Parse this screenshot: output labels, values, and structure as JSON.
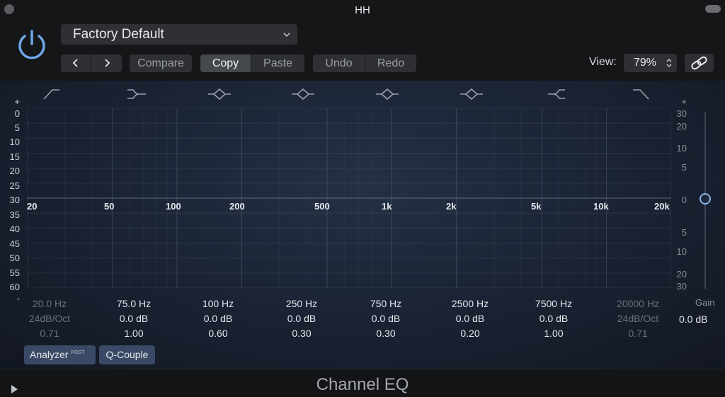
{
  "window": {
    "title": "HH"
  },
  "header": {
    "preset": "Factory Default",
    "compare_label": "Compare",
    "copy_label": "Copy",
    "paste_label": "Paste",
    "undo_label": "Undo",
    "redo_label": "Redo",
    "view_label": "View:",
    "view_value": "79%"
  },
  "graph": {
    "db_scale_left": [
      "+",
      "0",
      "5",
      "10",
      "15",
      "20",
      "25",
      "30",
      "35",
      "40",
      "45",
      "50",
      "55",
      "60",
      "-"
    ],
    "db_scale_right": [
      "+",
      "30",
      "20",
      "10",
      "5",
      "0",
      "5",
      "10",
      "20",
      "30"
    ],
    "freq_labels": [
      "20",
      "50",
      "100",
      "200",
      "500",
      "1k",
      "2k",
      "5k",
      "10k",
      "20k"
    ]
  },
  "bands": [
    {
      "freq": "20.0 Hz",
      "gain": "24dB/Oct",
      "q": "0.71",
      "enabled": false
    },
    {
      "freq": "75.0 Hz",
      "gain": "0.0 dB",
      "q": "1.00",
      "enabled": true
    },
    {
      "freq": "100 Hz",
      "gain": "0.0 dB",
      "q": "0.60",
      "enabled": true
    },
    {
      "freq": "250 Hz",
      "gain": "0.0 dB",
      "q": "0.30",
      "enabled": true
    },
    {
      "freq": "750 Hz",
      "gain": "0.0 dB",
      "q": "0.30",
      "enabled": true
    },
    {
      "freq": "2500 Hz",
      "gain": "0.0 dB",
      "q": "0.20",
      "enabled": true
    },
    {
      "freq": "7500 Hz",
      "gain": "0.0 dB",
      "q": "1.00",
      "enabled": true
    },
    {
      "freq": "20000 Hz",
      "gain": "24dB/Oct",
      "q": "0.71",
      "enabled": false
    }
  ],
  "gain": {
    "label": "Gain",
    "value": "0.0 dB"
  },
  "controls": {
    "analyzer_label": "Analyzer",
    "analyzer_badge": "POST",
    "qcouple_label": "Q-Couple"
  },
  "footer": {
    "title": "Channel EQ"
  },
  "colors": {
    "accent": "#6fa8e6",
    "background": "#1a2232",
    "button": "#2e3034"
  }
}
